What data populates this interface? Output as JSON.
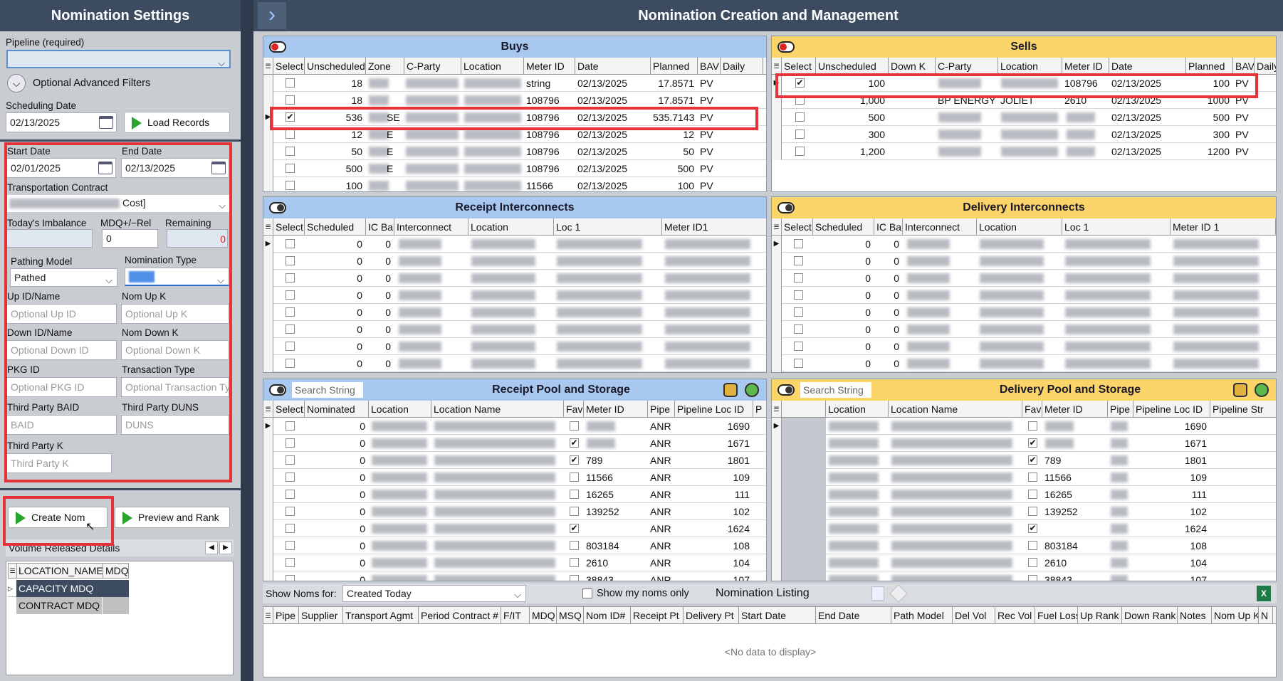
{
  "left": {
    "title": "Nomination Settings",
    "pipeline_label": "Pipeline (required)",
    "adv_filters": "Optional Advanced Filters",
    "scheduling_date_label": "Scheduling Date",
    "scheduling_date": "02/13/2025",
    "load_records": "Load Records",
    "start_date_label": "Start Date",
    "start_date": "02/01/2025",
    "end_date_label": "End Date",
    "end_date": "02/13/2025",
    "transport_contract_label": "Transportation Contract",
    "transport_contract_value": "Cost]",
    "imbalance_label": "Today's Imbalance",
    "mdq_label": "MDQ+/−Rel",
    "mdq_value": "0",
    "remaining_label": "Remaining",
    "remaining_value": "0",
    "pathing_label": "Pathing Model",
    "pathing_value": "Pathed",
    "nomtype_label": "Nomination Type",
    "upid_label": "Up ID/Name",
    "upid_ph": "Optional Up ID",
    "nomupk_label": "Nom Up K",
    "nomupk_ph": "Optional Up K",
    "downid_label": "Down ID/Name",
    "downid_ph": "Optional Down ID",
    "nomdownk_label": "Nom Down K",
    "nomdownk_ph": "Optional Down K",
    "pkg_label": "PKG ID",
    "pkg_ph": "Optional PKG ID",
    "trans_type_label": "Transaction Type",
    "trans_type_ph": "Optional Transaction Type",
    "baid_label": "Third Party BAID",
    "baid_ph": "BAID",
    "duns_label": "Third Party DUNS",
    "duns_ph": "DUNS",
    "thirdk_label": "Third Party K",
    "thirdk_ph": "Third Party K",
    "create_nom": "Create Nom",
    "preview_rank": "Preview and Rank",
    "vol_title": "Volume Released Details",
    "vol_headers": [
      "LOCATION_NAME",
      "MDQ"
    ],
    "vol_rows": [
      "CAPACITY MDQ",
      "CONTRACT MDQ"
    ]
  },
  "main": {
    "title": "Nomination Creation and Management",
    "buys": {
      "title": "Buys",
      "headers": [
        "Select",
        "Unscheduled",
        "Zone",
        "C-Party",
        "Location",
        "Meter ID",
        "Date",
        "Planned",
        "BAV",
        "Daily"
      ],
      "rows": [
        {
          "checked": false,
          "unsched": "18",
          "zone": "",
          "meter": "string",
          "date": "02/13/2025",
          "planned": "17.8571",
          "bav": "PV"
        },
        {
          "checked": false,
          "unsched": "18",
          "zone": "",
          "meter": "108796",
          "date": "02/13/2025",
          "planned": "17.8571",
          "bav": "PV"
        },
        {
          "checked": true,
          "unsched": "536",
          "zone": "SE",
          "meter": "108796",
          "date": "02/13/2025",
          "planned": "535.7143",
          "bav": "PV"
        },
        {
          "checked": false,
          "unsched": "12",
          "zone": "E",
          "meter": "108796",
          "date": "02/13/2025",
          "planned": "12",
          "bav": "PV"
        },
        {
          "checked": false,
          "unsched": "50",
          "zone": "E",
          "meter": "108796",
          "date": "02/13/2025",
          "planned": "50",
          "bav": "PV"
        },
        {
          "checked": false,
          "unsched": "500",
          "zone": "E",
          "meter": "108796",
          "date": "02/13/2025",
          "planned": "500",
          "bav": "PV"
        },
        {
          "checked": false,
          "unsched": "100",
          "zone": "",
          "meter": "11566",
          "date": "02/13/2025",
          "planned": "100",
          "bav": "PV"
        }
      ]
    },
    "sells": {
      "title": "Sells",
      "headers": [
        "Select",
        "Unscheduled",
        "Down K",
        "C-Party",
        "Location",
        "Meter ID",
        "Date",
        "Planned",
        "BAV",
        "Daily F"
      ],
      "rows": [
        {
          "checked": true,
          "unsched": "100",
          "cparty": "",
          "loc": "",
          "meter": "108796",
          "date": "02/13/2025",
          "planned": "100",
          "bav": "PV"
        },
        {
          "checked": false,
          "unsched": "1,000",
          "cparty": "BP ENERGY",
          "loc": "JOLIET",
          "meter": "2610",
          "date": "02/13/2025",
          "planned": "1000",
          "bav": "PV"
        },
        {
          "checked": false,
          "unsched": "500",
          "cparty": "",
          "loc": "",
          "meter": "",
          "date": "02/13/2025",
          "planned": "500",
          "bav": "PV"
        },
        {
          "checked": false,
          "unsched": "300",
          "cparty": "",
          "loc": "",
          "meter": "",
          "date": "02/13/2025",
          "planned": "300",
          "bav": "PV"
        },
        {
          "checked": false,
          "unsched": "1,200",
          "cparty": "",
          "loc": "",
          "meter": "",
          "date": "02/13/2025",
          "planned": "1200",
          "bav": "PV"
        }
      ]
    },
    "receipt_ic": {
      "title": "Receipt Interconnects",
      "headers": [
        "Select",
        "Scheduled",
        "IC Bal",
        "Interconnect",
        "Location",
        "Loc 1",
        "Meter ID1"
      ],
      "rows": [
        "0",
        "0",
        "0",
        "0",
        "0",
        "0",
        "0",
        "0"
      ]
    },
    "delivery_ic": {
      "title": "Delivery Interconnects",
      "headers": [
        "Select",
        "Scheduled",
        "IC Bal",
        "Interconnect",
        "Location",
        "Loc 1",
        "Meter ID 1"
      ],
      "rows": [
        "0",
        "0",
        "0",
        "0",
        "0",
        "0",
        "0",
        "0"
      ]
    },
    "receipt_pool": {
      "title": "Receipt Pool and Storage",
      "search": "Search String",
      "headers": [
        "Select",
        "Nominated",
        "Location",
        "Location Name",
        "Fav",
        "Meter ID",
        "Pipe",
        "Pipeline Loc ID",
        "P"
      ],
      "rows": [
        {
          "nom": "0",
          "fav": false,
          "meter": "",
          "pipe": "ANR",
          "ploc": "1690"
        },
        {
          "nom": "0",
          "fav": true,
          "meter": "",
          "pipe": "ANR",
          "ploc": "1671"
        },
        {
          "nom": "0",
          "fav": true,
          "meter": "789",
          "pipe": "ANR",
          "ploc": "1801"
        },
        {
          "nom": "0",
          "fav": false,
          "meter": "11566",
          "pipe": "ANR",
          "ploc": "109"
        },
        {
          "nom": "0",
          "fav": false,
          "meter": "16265",
          "pipe": "ANR",
          "ploc": "111"
        },
        {
          "nom": "0",
          "fav": false,
          "meter": "139252",
          "pipe": "ANR",
          "ploc": "102"
        },
        {
          "nom": "0",
          "fav": true,
          "meter": "",
          "pipe": "ANR",
          "ploc": "1624"
        },
        {
          "nom": "0",
          "fav": false,
          "meter": "803184",
          "pipe": "ANR",
          "ploc": "108"
        },
        {
          "nom": "0",
          "fav": false,
          "meter": "2610",
          "pipe": "ANR",
          "ploc": "104"
        },
        {
          "nom": "0",
          "fav": false,
          "meter": "38843",
          "pipe": "ANR",
          "ploc": "107"
        }
      ]
    },
    "delivery_pool": {
      "title": "Delivery Pool and Storage",
      "search": "Search String",
      "headers": [
        "",
        "Location",
        "Location Name",
        "Fav",
        "Meter ID",
        "Pipe",
        "Pipeline Loc ID",
        "Pipeline Str"
      ],
      "rows": [
        {
          "fav": false,
          "meter": "",
          "ploc": "1690"
        },
        {
          "fav": true,
          "meter": "",
          "ploc": "1671"
        },
        {
          "fav": true,
          "meter": "789",
          "ploc": "1801"
        },
        {
          "fav": false,
          "meter": "11566",
          "ploc": "109"
        },
        {
          "fav": false,
          "meter": "16265",
          "ploc": "111"
        },
        {
          "fav": false,
          "meter": "139252",
          "ploc": "102"
        },
        {
          "fav": true,
          "meter": "",
          "ploc": "1624"
        },
        {
          "fav": false,
          "meter": "803184",
          "ploc": "108"
        },
        {
          "fav": false,
          "meter": "2610",
          "ploc": "104"
        },
        {
          "fav": false,
          "meter": "38843",
          "ploc": "107"
        }
      ]
    },
    "listing": {
      "show_noms_label": "Show Noms for:",
      "show_noms_value": "Created Today",
      "my_noms": "Show my noms only",
      "title": "Nomination Listing",
      "headers": [
        "Pipe",
        "Supplier",
        "Transport Agmt",
        "Period Contract #",
        "F/IT",
        "MDQ",
        "MSQ",
        "Nom ID#",
        "Receipt Pt",
        "Delivery Pt",
        "Start Date",
        "End Date",
        "Path Model",
        "Del Vol",
        "Rec Vol",
        "Fuel Loss",
        "Up Rank",
        "Down Rank",
        "Notes",
        "Nom Up K",
        "N"
      ],
      "empty": "<No data to display>"
    }
  },
  "colors": {
    "header": "#3c4b5f",
    "blue_panel": "#a9c8ef",
    "yellow_panel": "#fbd46a",
    "highlight": "#e4343a"
  }
}
